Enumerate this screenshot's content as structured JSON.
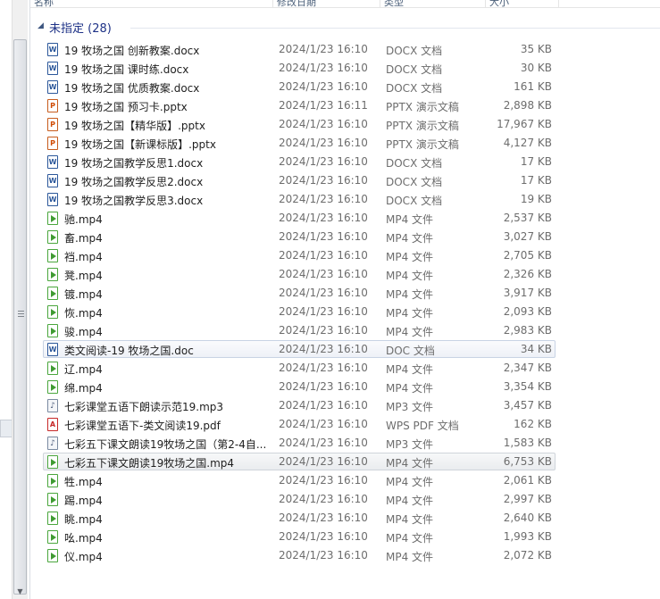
{
  "header": {
    "columns": [
      "名称",
      "修改日期",
      "类型",
      "大小"
    ]
  },
  "group": {
    "title": "未指定 (28)"
  },
  "files": [
    {
      "name": "19 牧场之国 创新教案.docx",
      "date": "2024/1/23 16:10",
      "type": "DOCX 文档",
      "size": "35 KB",
      "icon": "docx"
    },
    {
      "name": "19 牧场之国 课时练.docx",
      "date": "2024/1/23 16:10",
      "type": "DOCX 文档",
      "size": "30 KB",
      "icon": "docx"
    },
    {
      "name": "19 牧场之国 优质教案.docx",
      "date": "2024/1/23 16:10",
      "type": "DOCX 文档",
      "size": "161 KB",
      "icon": "docx"
    },
    {
      "name": "19 牧场之国 预习卡.pptx",
      "date": "2024/1/23 16:11",
      "type": "PPTX 演示文稿",
      "size": "2,898 KB",
      "icon": "pptx"
    },
    {
      "name": "19 牧场之国【精华版】.pptx",
      "date": "2024/1/23 16:10",
      "type": "PPTX 演示文稿",
      "size": "17,967 KB",
      "icon": "pptx"
    },
    {
      "name": "19 牧场之国【新课标版】.pptx",
      "date": "2024/1/23 16:10",
      "type": "PPTX 演示文稿",
      "size": "4,127 KB",
      "icon": "pptx"
    },
    {
      "name": "19 牧场之国教学反思1.docx",
      "date": "2024/1/23 16:10",
      "type": "DOCX 文档",
      "size": "17 KB",
      "icon": "docx"
    },
    {
      "name": "19 牧场之国教学反思2.docx",
      "date": "2024/1/23 16:10",
      "type": "DOCX 文档",
      "size": "17 KB",
      "icon": "docx"
    },
    {
      "name": "19 牧场之国教学反思3.docx",
      "date": "2024/1/23 16:10",
      "type": "DOCX 文档",
      "size": "19 KB",
      "icon": "docx"
    },
    {
      "name": "驰.mp4",
      "date": "2024/1/23 16:10",
      "type": "MP4 文件",
      "size": "2,537 KB",
      "icon": "mp4"
    },
    {
      "name": "畜.mp4",
      "date": "2024/1/23 16:10",
      "type": "MP4 文件",
      "size": "3,027 KB",
      "icon": "mp4"
    },
    {
      "name": "裆.mp4",
      "date": "2024/1/23 16:10",
      "type": "MP4 文件",
      "size": "2,705 KB",
      "icon": "mp4"
    },
    {
      "name": "凳.mp4",
      "date": "2024/1/23 16:10",
      "type": "MP4 文件",
      "size": "2,326 KB",
      "icon": "mp4"
    },
    {
      "name": "镀.mp4",
      "date": "2024/1/23 16:10",
      "type": "MP4 文件",
      "size": "3,917 KB",
      "icon": "mp4"
    },
    {
      "name": "恢.mp4",
      "date": "2024/1/23 16:10",
      "type": "MP4 文件",
      "size": "2,093 KB",
      "icon": "mp4"
    },
    {
      "name": "骏.mp4",
      "date": "2024/1/23 16:10",
      "type": "MP4 文件",
      "size": "2,983 KB",
      "icon": "mp4"
    },
    {
      "name": "类文阅读-19 牧场之国.doc",
      "date": "2024/1/23 16:10",
      "type": "DOC 文档",
      "size": "34 KB",
      "icon": "doc"
    },
    {
      "name": "辽.mp4",
      "date": "2024/1/23 16:10",
      "type": "MP4 文件",
      "size": "2,347 KB",
      "icon": "mp4"
    },
    {
      "name": "绵.mp4",
      "date": "2024/1/23 16:10",
      "type": "MP4 文件",
      "size": "3,354 KB",
      "icon": "mp4"
    },
    {
      "name": "七彩课堂五语下朗读示范19.mp3",
      "date": "2024/1/23 16:10",
      "type": "MP3 文件",
      "size": "3,457 KB",
      "icon": "mp3"
    },
    {
      "name": "七彩课堂五语下-类文阅读19.pdf",
      "date": "2024/1/23 16:10",
      "type": "WPS PDF 文档",
      "size": "162 KB",
      "icon": "pdf"
    },
    {
      "name": "七彩五下课文朗读19牧场之国（第2-4自...",
      "date": "2024/1/23 16:10",
      "type": "MP3 文件",
      "size": "1,583 KB",
      "icon": "mp3"
    },
    {
      "name": "七彩五下课文朗读19牧场之国.mp4",
      "date": "2024/1/23 16:10",
      "type": "MP4 文件",
      "size": "6,753 KB",
      "icon": "mp4"
    },
    {
      "name": "牲.mp4",
      "date": "2024/1/23 16:10",
      "type": "MP4 文件",
      "size": "2,061 KB",
      "icon": "mp4"
    },
    {
      "name": "踢.mp4",
      "date": "2024/1/23 16:10",
      "type": "MP4 文件",
      "size": "2,997 KB",
      "icon": "mp4"
    },
    {
      "name": "眺.mp4",
      "date": "2024/1/23 16:10",
      "type": "MP4 文件",
      "size": "2,640 KB",
      "icon": "mp4"
    },
    {
      "name": "吆.mp4",
      "date": "2024/1/23 16:10",
      "type": "MP4 文件",
      "size": "1,993 KB",
      "icon": "mp4"
    },
    {
      "name": "仪.mp4",
      "date": "2024/1/23 16:10",
      "type": "MP4 文件",
      "size": "2,072 KB",
      "icon": "mp4"
    }
  ],
  "icons": {
    "collapse": "chevron-down-icon",
    "scroll_down": "arrow-down-icon"
  },
  "colors": {
    "group_title": "#1e3287",
    "selection_border": "#c8d3e4"
  }
}
